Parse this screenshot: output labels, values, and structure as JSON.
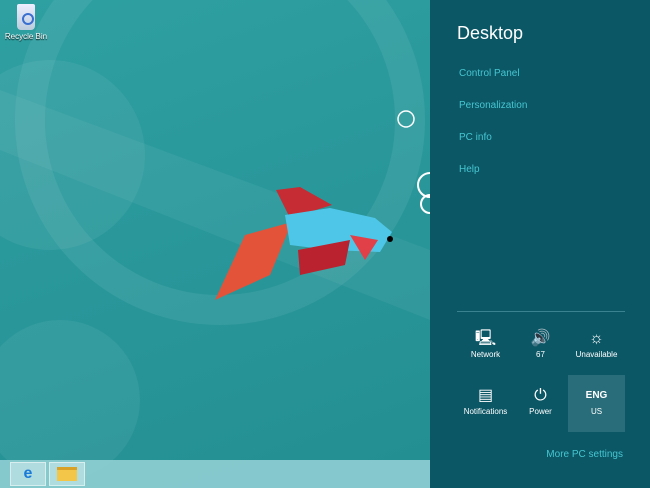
{
  "desktop": {
    "icons": [
      {
        "label": "Recycle Bin"
      }
    ]
  },
  "charm": {
    "title": "Desktop",
    "links": [
      "Control Panel",
      "Personalization",
      "PC info",
      "Help"
    ],
    "tiles": [
      {
        "icon": "network-icon",
        "label": "Network"
      },
      {
        "icon": "volume-icon",
        "label": "67"
      },
      {
        "icon": "brightness-icon",
        "label": "Unavailable"
      },
      {
        "icon": "notifications-icon",
        "label": "Notifications"
      },
      {
        "icon": "power-icon",
        "label": "Power"
      },
      {
        "icon": "keyboard-language",
        "glyph": "ENG",
        "label": "US"
      }
    ],
    "more": "More PC settings"
  },
  "colors": {
    "charm_bg": "#0c5766",
    "accent_link": "#45c6d0"
  }
}
